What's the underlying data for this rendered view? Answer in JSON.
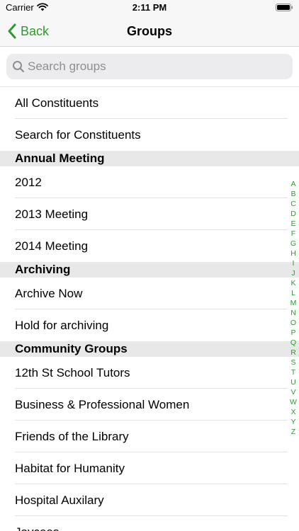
{
  "status_bar": {
    "carrier": "Carrier",
    "time": "2:11 PM"
  },
  "nav": {
    "back_label": "Back",
    "title": "Groups"
  },
  "search": {
    "placeholder": "Search groups",
    "value": ""
  },
  "top_items": [
    {
      "label": "All Constituents"
    },
    {
      "label": "Search for Constituents"
    }
  ],
  "sections": [
    {
      "title": "Annual Meeting",
      "items": [
        {
          "label": "2012"
        },
        {
          "label": "2013 Meeting"
        },
        {
          "label": "2014 Meeting"
        }
      ]
    },
    {
      "title": "Archiving",
      "items": [
        {
          "label": "Archive Now"
        },
        {
          "label": "Hold for archiving"
        }
      ]
    },
    {
      "title": "Community Groups",
      "items": [
        {
          "label": "12th St School Tutors"
        },
        {
          "label": "Business & Professional Women"
        },
        {
          "label": "Friends of the Library"
        },
        {
          "label": "Habitat for Humanity"
        },
        {
          "label": "Hospital Auxilary"
        },
        {
          "label": "Jaycees"
        }
      ]
    }
  ],
  "index_letters": [
    "A",
    "B",
    "C",
    "D",
    "E",
    "F",
    "G",
    "H",
    "I",
    "J",
    "K",
    "L",
    "M",
    "N",
    "O",
    "P",
    "Q",
    "R",
    "S",
    "T",
    "U",
    "V",
    "W",
    "X",
    "Y",
    "Z"
  ],
  "colors": {
    "accent": "#2e9a2e",
    "section_bg": "#e8e8e8",
    "search_bg": "#ececee",
    "bar_bg": "#f7f7f7"
  },
  "icons": {
    "back": "chevron-left-icon",
    "search": "magnifier-icon",
    "wifi": "wifi-icon",
    "battery": "battery-icon"
  }
}
